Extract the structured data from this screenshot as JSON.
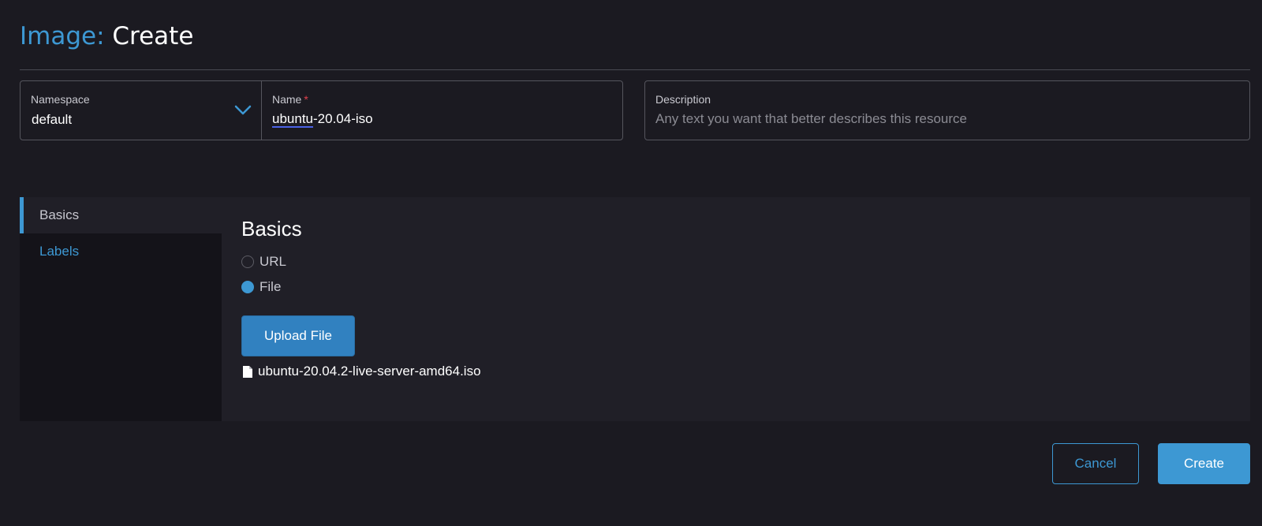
{
  "header": {
    "crumb": "Image:",
    "action": "Create"
  },
  "form": {
    "namespace": {
      "label": "Namespace",
      "value": "default"
    },
    "name": {
      "label": "Name",
      "required_mark": "*",
      "value_underlined": "ubuntu",
      "value_rest": "-20.04-iso"
    },
    "description": {
      "label": "Description",
      "placeholder": "Any text you want that better describes this resource"
    }
  },
  "tabs": [
    {
      "label": "Basics",
      "active": true
    },
    {
      "label": "Labels",
      "active": false
    }
  ],
  "basics": {
    "title": "Basics",
    "source_options": [
      {
        "label": "URL",
        "checked": false
      },
      {
        "label": "File",
        "checked": true
      }
    ],
    "upload_label": "Upload File",
    "file_name": "ubuntu-20.04.2-live-server-amd64.iso"
  },
  "footer": {
    "cancel_label": "Cancel",
    "create_label": "Create"
  },
  "colors": {
    "accent": "#3d98d3",
    "background": "#1b1a21",
    "required": "#e0414d"
  },
  "icons": {
    "namespace_toggle": "chevron-down-icon",
    "file": "file-icon"
  }
}
